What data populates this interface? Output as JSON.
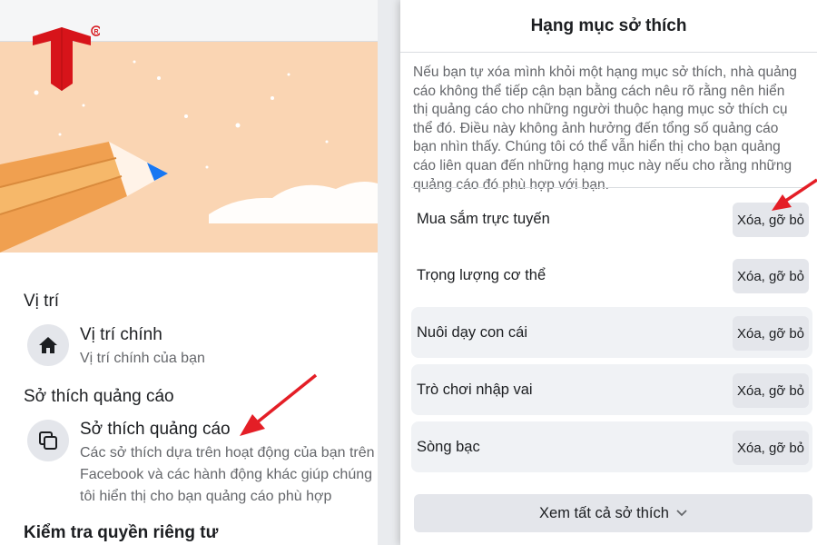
{
  "left": {
    "location_section_title": "Vị trí",
    "primary_location": {
      "title": "Vị trí chính",
      "subtitle": "Vị trí chính của bạn",
      "icon": "home-icon"
    },
    "ad_interests_section_title": "Sở thích quảng cáo",
    "ad_interests": {
      "title": "Sở thích quảng cáo",
      "subtitle": "Các sở thích dựa trên hoạt động của bạn trên\nFacebook và các hành động khác giúp chúng\ntôi hiển thị cho bạn quảng cáo phù hợp",
      "icon": "stacked-pages-icon"
    },
    "privacy_checkup_title": "Kiểm tra quyền riêng tư"
  },
  "dialog": {
    "title": "Hạng mục sở thích",
    "description": "Nếu bạn tự xóa mình khỏi một hạng mục sở thích, nhà quảng cáo không thể tiếp cận bạn bằng cách nêu rõ rằng nên hiển thị quảng cáo cho những người thuộc hạng mục sở thích cụ thể đó. Điều này không ảnh hưởng đến tổng số quảng cáo bạn nhìn thấy. Chúng tôi có thể vẫn hiển thị cho bạn quảng cáo liên quan đến những hạng mục này nếu cho rằng những quảng cáo đó phù hợp với bạn.",
    "interests": [
      {
        "label": "Mua sắm trực tuyến",
        "button": "Xóa, gỡ bỏ"
      },
      {
        "label": "Trọng lượng cơ thể",
        "button": "Xóa, gỡ bỏ"
      },
      {
        "label": "Nuôi dạy con cái",
        "button": "Xóa, gỡ bỏ"
      },
      {
        "label": "Trò chơi nhập vai",
        "button": "Xóa, gỡ bỏ"
      },
      {
        "label": "Sòng bạc",
        "button": "Xóa, gỡ bỏ"
      }
    ],
    "see_all_label": "Xem tất cả sở thích",
    "see_all_icon": "chevron-down-icon"
  },
  "colors": {
    "logo_red": "#d7141a",
    "arrow_red": "#e41e26",
    "banner_peach": "#fad5b3",
    "pencil_orange": "#f0a050",
    "pencil_tip_blue": "#1877f2"
  }
}
